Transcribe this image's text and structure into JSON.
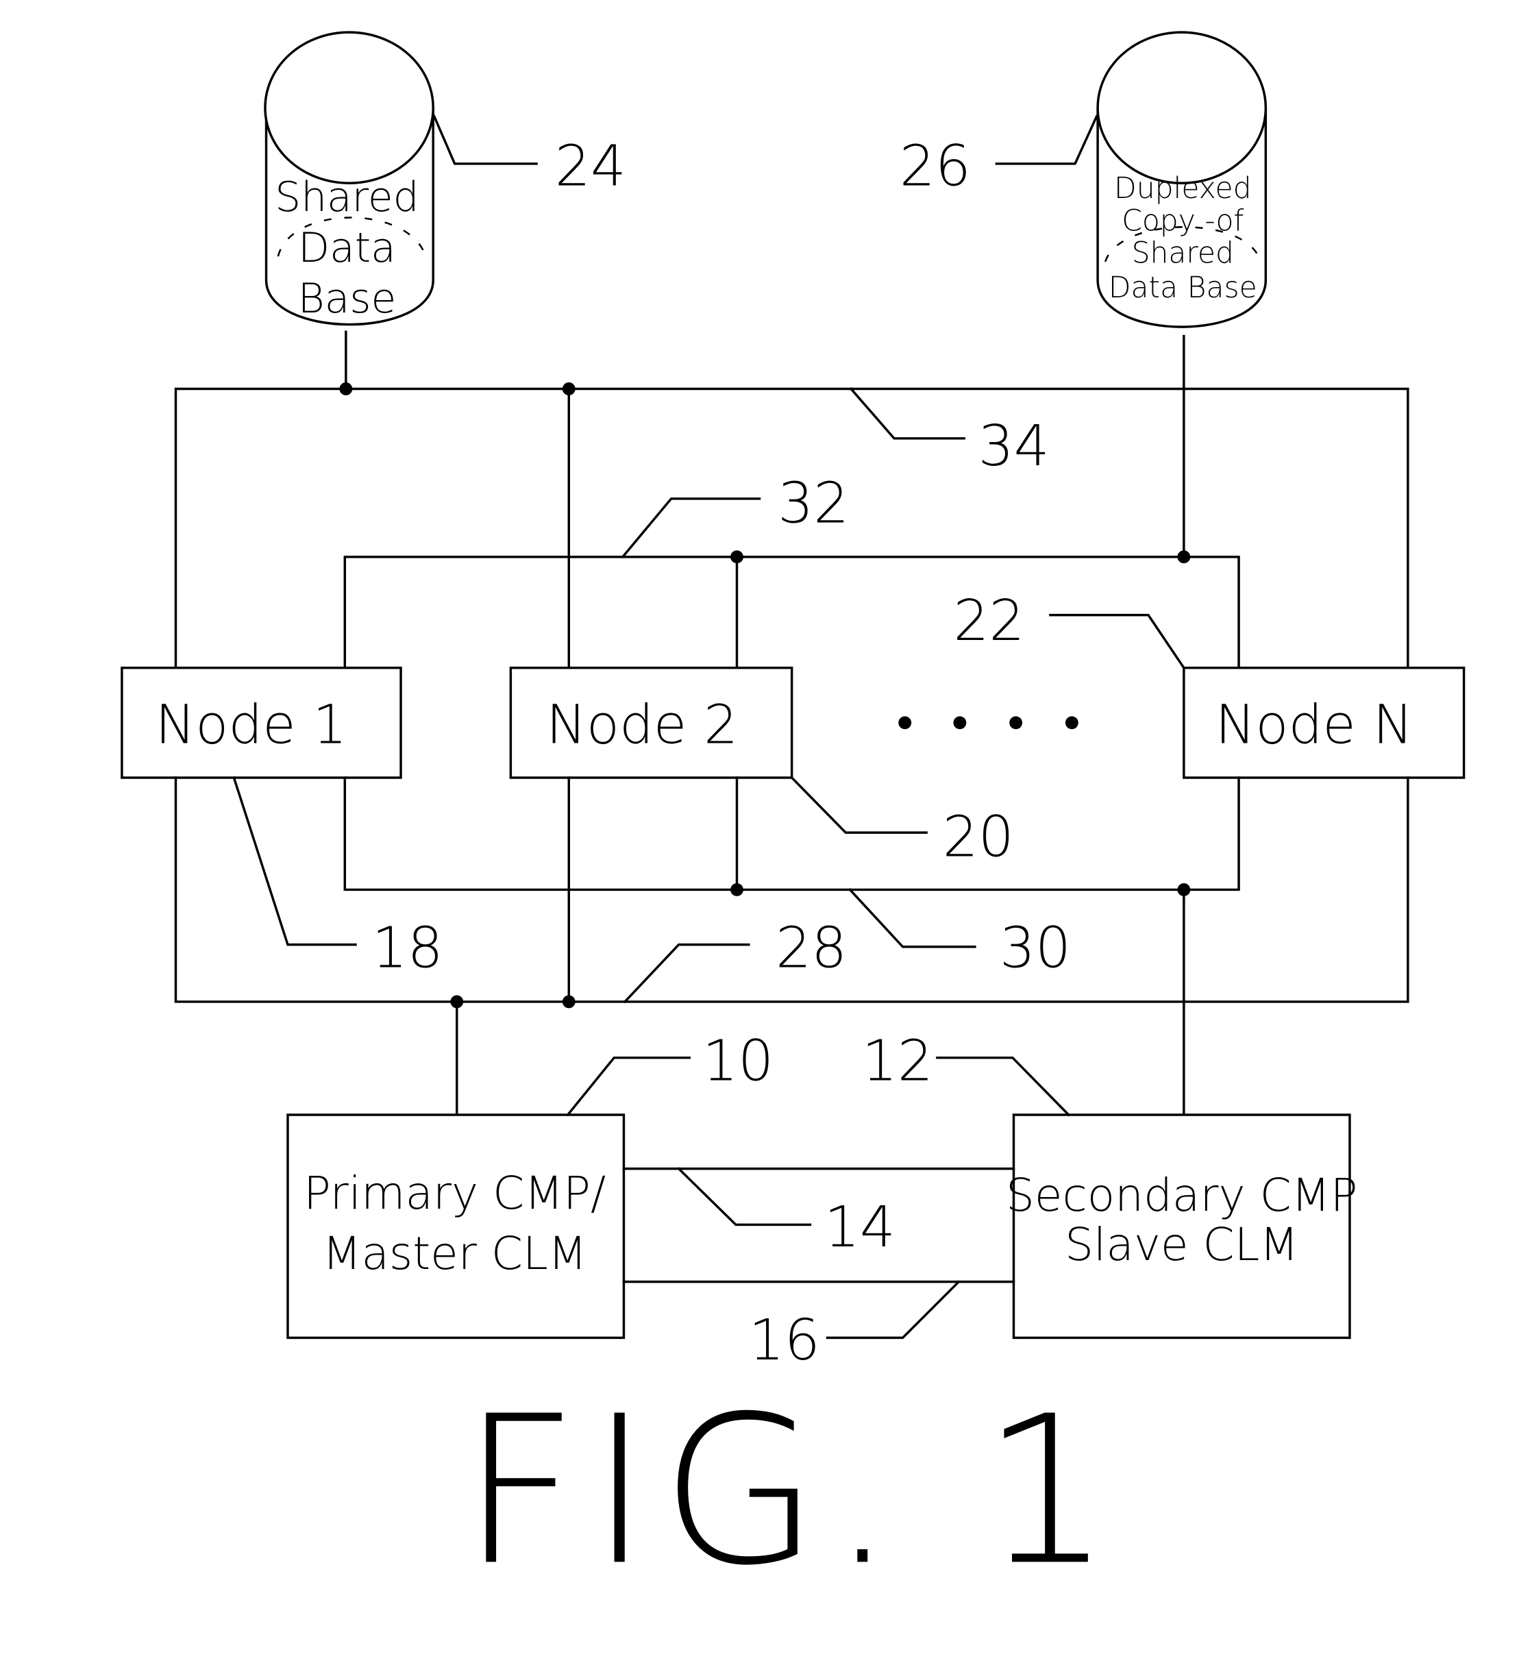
{
  "figure": {
    "caption": "FIG. 1",
    "databases": [
      {
        "id": "shared-db",
        "ref": "24",
        "lines": [
          "Shared",
          "Data",
          "Base"
        ]
      },
      {
        "id": "duplex-db",
        "ref": "26",
        "lines": [
          "Duplexed",
          "Copy -of",
          "Shared",
          "Data Base"
        ]
      }
    ],
    "nodes": [
      {
        "id": "node-1",
        "label": "Node 1",
        "ref": "18"
      },
      {
        "id": "node-2",
        "label": "Node 2",
        "ref": "20"
      },
      {
        "id": "node-n",
        "label": "Node N",
        "ref": "22"
      }
    ],
    "ellipsis": "• • • •",
    "processors": [
      {
        "id": "primary",
        "ref": "10",
        "lines": [
          "Primary CMP/",
          "Master CLM"
        ]
      },
      {
        "id": "secondary",
        "ref": "12",
        "lines": [
          "Secondary CMP",
          "Slave CLM"
        ]
      }
    ],
    "links": [
      {
        "id": "link-14",
        "ref": "14"
      },
      {
        "id": "link-16",
        "ref": "16"
      }
    ],
    "buses": [
      {
        "id": "bus-34",
        "ref": "34"
      },
      {
        "id": "bus-32",
        "ref": "32"
      },
      {
        "id": "bus-30",
        "ref": "30"
      },
      {
        "id": "bus-28",
        "ref": "28"
      }
    ]
  }
}
